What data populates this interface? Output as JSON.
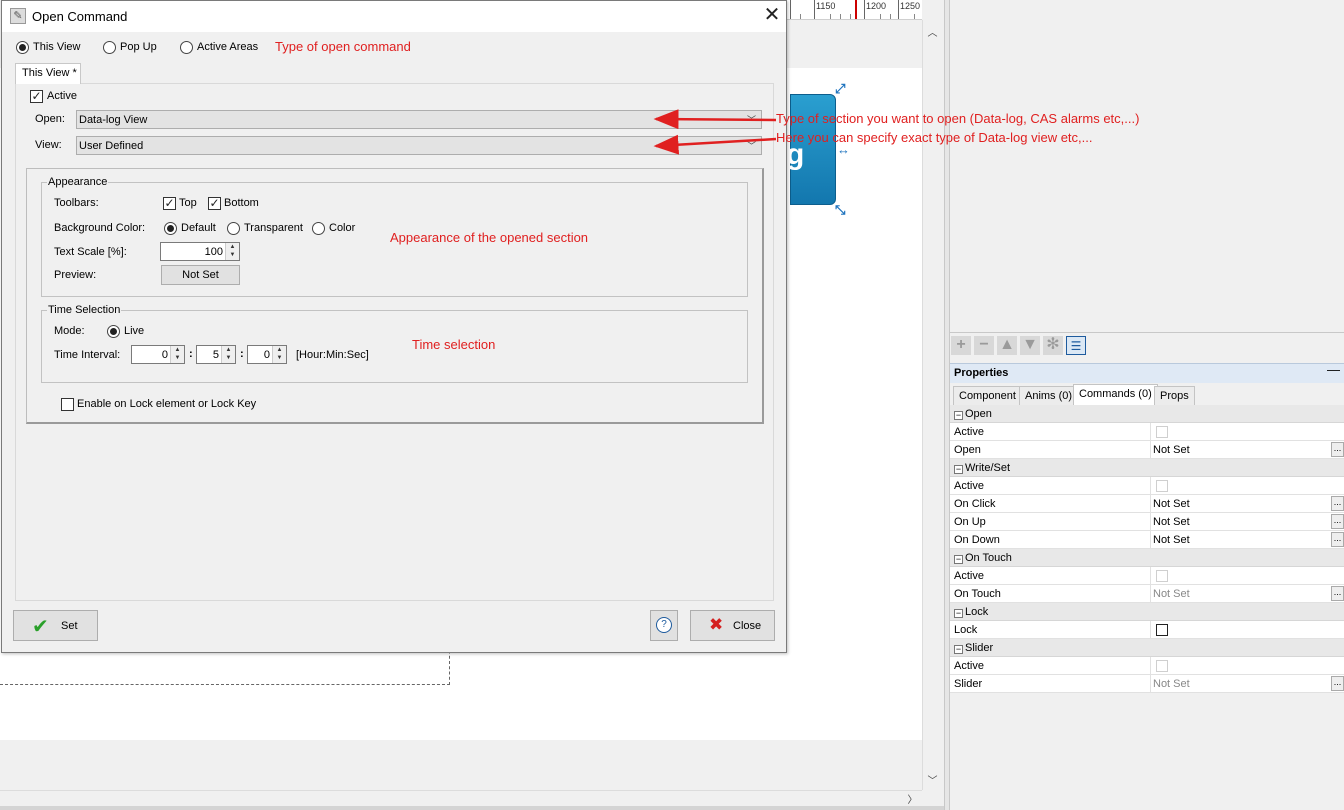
{
  "background": {
    "ruler": {
      "labels": [
        "1150",
        "1200",
        "1250"
      ]
    },
    "widget": {
      "glyph": "g"
    }
  },
  "properties_panel": {
    "title": "Properties",
    "tabs": [
      "Component",
      "Anims (0)",
      "Commands (0)",
      "Props"
    ],
    "selected_tab": "Commands (0)",
    "rows": [
      {
        "kind": "category",
        "name": "Open"
      },
      {
        "kind": "check",
        "name": "Active"
      },
      {
        "kind": "value",
        "name": "Open",
        "value": "Not Set"
      },
      {
        "kind": "category",
        "name": "Write/Set"
      },
      {
        "kind": "check",
        "name": "Active"
      },
      {
        "kind": "value",
        "name": "On Click",
        "value": "Not Set"
      },
      {
        "kind": "value",
        "name": "On Up",
        "value": "Not Set"
      },
      {
        "kind": "value",
        "name": "On Down",
        "value": "Not Set"
      },
      {
        "kind": "category",
        "name": "On Touch"
      },
      {
        "kind": "check",
        "name": "Active"
      },
      {
        "kind": "value-muted",
        "name": "On Touch",
        "value": "Not Set"
      },
      {
        "kind": "category",
        "name": "Lock"
      },
      {
        "kind": "check-dark",
        "name": "Lock"
      },
      {
        "kind": "category",
        "name": "Slider"
      },
      {
        "kind": "check",
        "name": "Active"
      },
      {
        "kind": "value-muted",
        "name": "Slider",
        "value": "Not Set"
      }
    ],
    "dots_label": "..."
  },
  "dialog": {
    "title": "Open Command",
    "close_symbol": "✕",
    "command_types": {
      "this_view": "This View",
      "pop_up": "Pop Up",
      "active_areas": "Active Areas",
      "selected": "This View"
    },
    "tab_label": "This View *",
    "active_label": "Active",
    "active_checked": true,
    "open_label": "Open:",
    "open_value": "Data-log View",
    "view_label": "View:",
    "view_value": "User Defined",
    "appearance": {
      "title": "Appearance",
      "toolbars_label": "Toolbars:",
      "top_label": "Top",
      "top_checked": true,
      "bottom_label": "Bottom",
      "bottom_checked": true,
      "bg_color_label": "Background Color:",
      "bg_default": "Default",
      "bg_transparent": "Transparent",
      "bg_color": "Color",
      "bg_selected": "Default",
      "text_scale_label": "Text Scale [%]:",
      "text_scale_value": "100",
      "preview_label": "Preview:",
      "preview_button": "Not Set"
    },
    "time_selection": {
      "title": "Time Selection",
      "mode_label": "Mode:",
      "mode_live": "Live",
      "interval_label": "Time Interval:",
      "hours": "0",
      "minutes": "5",
      "seconds": "0",
      "separator": ":",
      "units": "[Hour:Min:Sec]"
    },
    "lock_label": "Enable on Lock element or Lock Key",
    "lock_checked": false,
    "set_button": "Set",
    "help_symbol": "?",
    "close_button": "Close"
  },
  "annotations": {
    "type_of_command": "Type of open command",
    "section_type": "Type of section you want to open (Data-log, CAS alarms etc,...)",
    "view_type": "Here you can specify exact type of Data-log view etc,...",
    "appearance_note": "Appearance of the opened section",
    "time_note": "Time selection",
    "color": "#e02020"
  }
}
